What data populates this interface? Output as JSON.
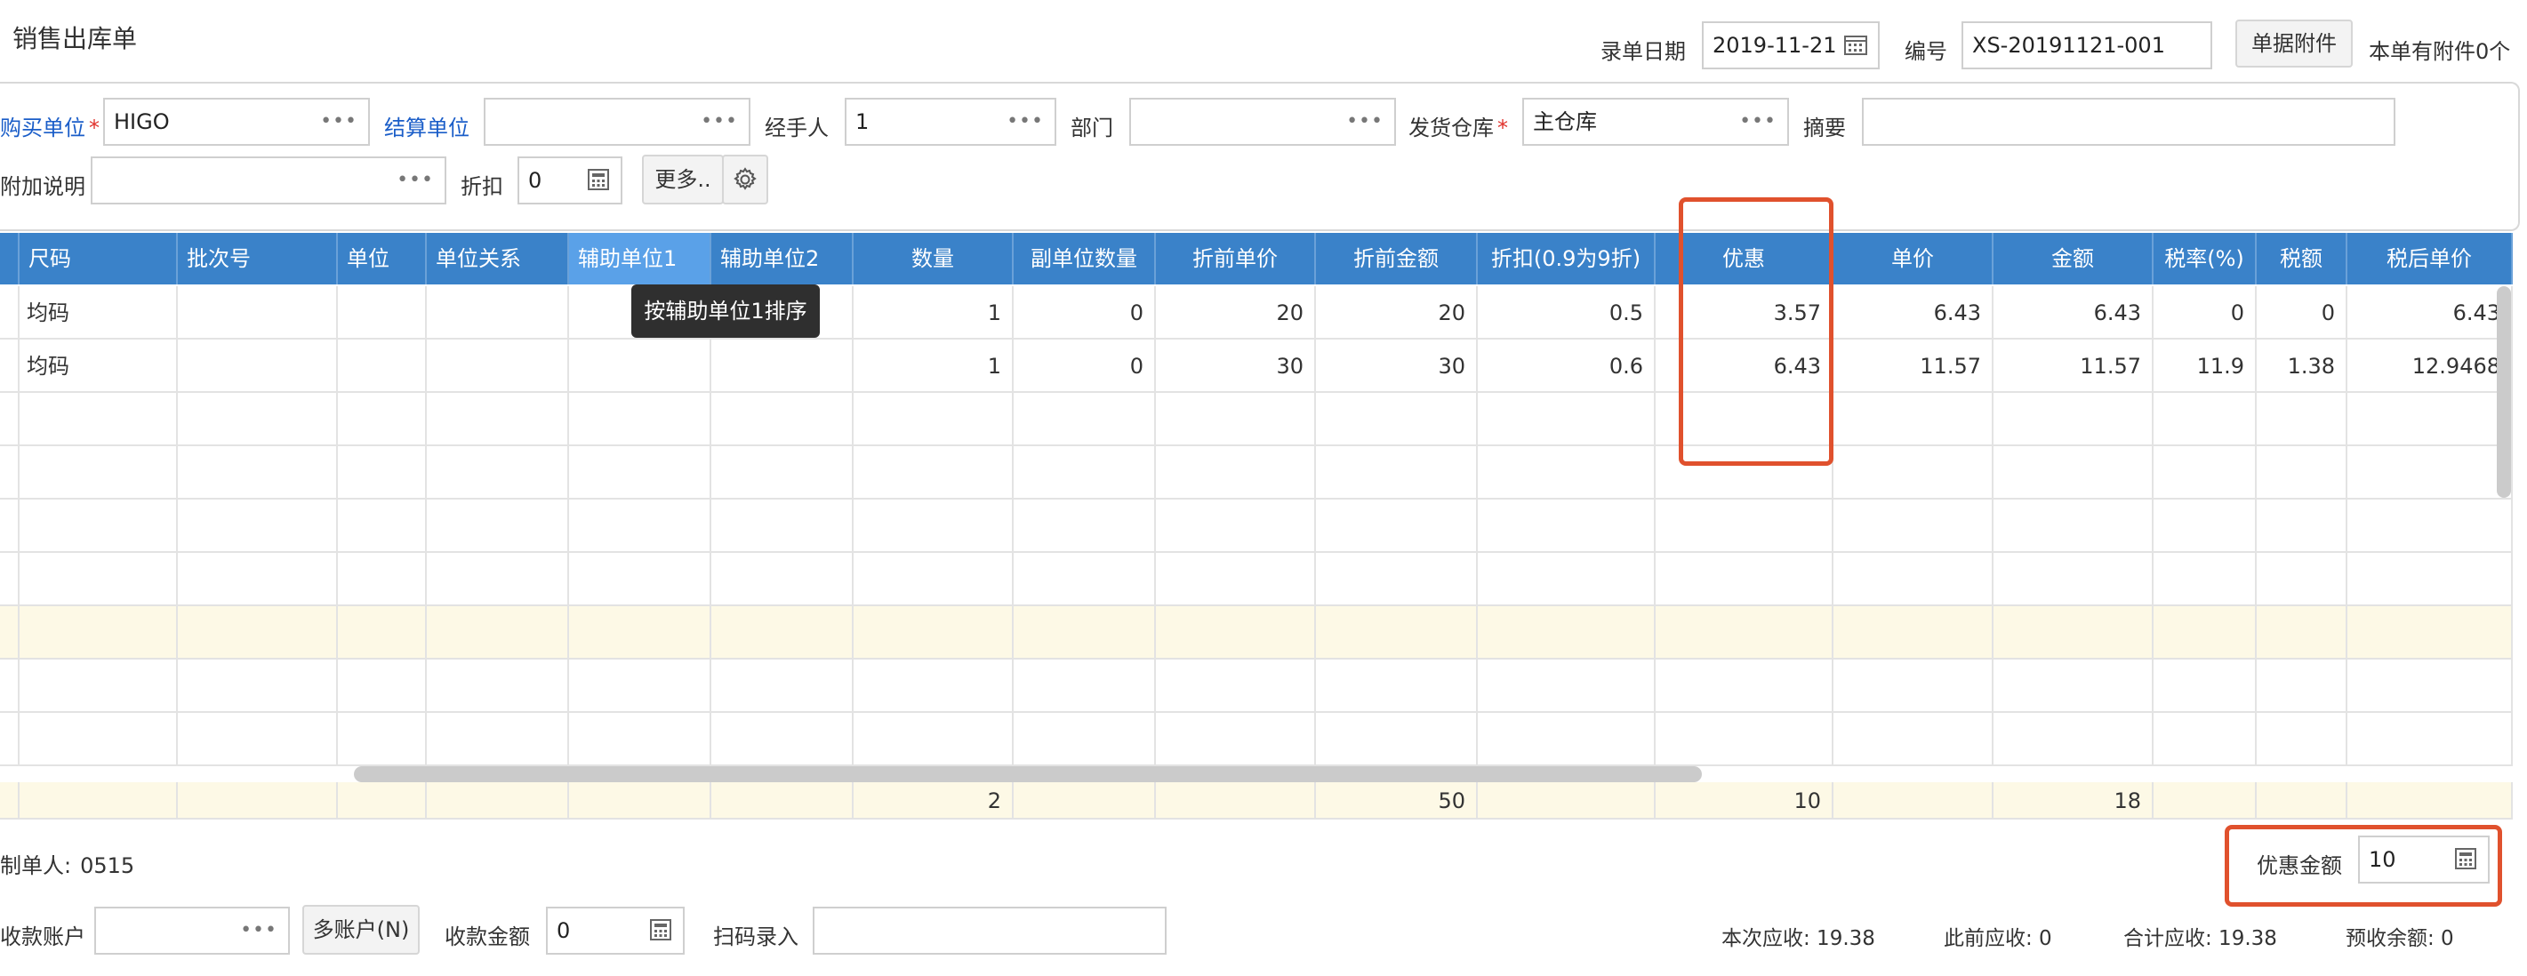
{
  "page": {
    "title": "销售出库单",
    "entry_date_label": "录单日期",
    "entry_date_value": "2019-11-21",
    "number_label": "编号",
    "number_value": "XS-20191121-001",
    "attach_button": "单据附件",
    "attach_status": "本单有附件0个"
  },
  "form": {
    "buyer_label": "购买单位",
    "buyer_value": "HIGO",
    "settle_label": "结算单位",
    "settle_value": "",
    "handler_label": "经手人",
    "handler_value": "1",
    "dept_label": "部门",
    "dept_value": "",
    "warehouse_label": "发货仓库",
    "warehouse_value": "主仓库",
    "summary_label": "摘要",
    "summary_value": "",
    "note_label": "附加说明",
    "note_value": "",
    "discount_label": "折扣",
    "discount_value": "0",
    "more_button": "更多..",
    "required_mark": "*"
  },
  "table": {
    "columns": [
      "尺码",
      "批次号",
      "单位",
      "单位关系",
      "辅助单位1",
      "辅助单位2",
      "数量",
      "副单位数量",
      "折前单价",
      "折前金额",
      "折扣(0.9为9折)",
      "优惠",
      "单价",
      "金额",
      "税率(%)",
      "税额",
      "税后单价"
    ],
    "rows": [
      [
        "均码",
        "",
        "",
        "",
        "",
        "",
        "1",
        "0",
        "20",
        "20",
        "0.5",
        "3.57",
        "6.43",
        "6.43",
        "0",
        "0",
        "6.43"
      ],
      [
        "均码",
        "",
        "",
        "",
        "",
        "",
        "1",
        "0",
        "30",
        "30",
        "0.6",
        "6.43",
        "11.57",
        "11.57",
        "11.9",
        "1.38",
        "12.9468"
      ]
    ],
    "totals": [
      "",
      "",
      "",
      "",
      "",
      "",
      "2",
      "",
      "",
      "50",
      "",
      "10",
      "",
      "18",
      "",
      "",
      ""
    ],
    "tooltip": "按辅助单位1排序"
  },
  "footer": {
    "maker_label": "制单人:",
    "maker_value": "0515",
    "discount_amount_label": "优惠金额",
    "discount_amount_value": "10",
    "account_label": "收款账户",
    "account_value": "",
    "multi_account_button": "多账户(N)",
    "receive_amount_label": "收款金额",
    "receive_amount_value": "0",
    "scan_label": "扫码录入",
    "scan_value": "",
    "current_receivable": "本次应收: 19.38",
    "previous_receivable": "此前应收: 0",
    "total_receivable": "合计应收: 19.38",
    "prepaid_balance": "预收余额: 0"
  },
  "colors": {
    "header_bg": "#3a82c9",
    "header_selected_bg": "#5aa1e8",
    "highlight_box": "#e0512d",
    "link_blue": "#1a5dc8",
    "footer_row_bg": "#fdf9e6"
  }
}
